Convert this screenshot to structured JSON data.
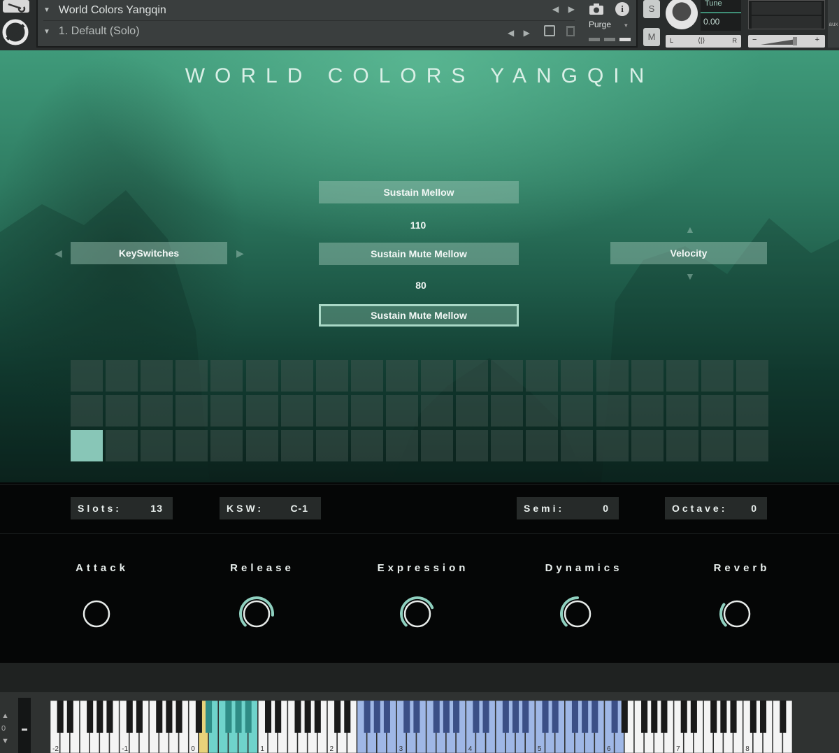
{
  "header": {
    "instrument_name": "World Colors Yangqin",
    "preset_name": "1. Default (Solo)",
    "purge_label": "Purge",
    "solo_label": "S",
    "mute_label": "M",
    "tune_label": "Tune",
    "tune_value": "0.00",
    "pan_left": "L",
    "pan_right": "R",
    "vol_minus": "−",
    "vol_plus": "+",
    "aux_label": "aux",
    "info_label": "i"
  },
  "title": "WORLD COLORS YANGQIN",
  "articulations": {
    "slot1": "Sustain Mellow",
    "value1": "110",
    "slot2": "Sustain Mute Mellow",
    "value2": "80",
    "slot3": "Sustain Mute Mellow"
  },
  "keyswitches_label": "KeySwitches",
  "velocity_label": "Velocity",
  "pad_grid": {
    "rows": 3,
    "cols": 20,
    "active_index": 40
  },
  "fields": {
    "slots_label": "Slots:",
    "slots_value": "13",
    "ksw_label": "KSW:",
    "ksw_value": "C-1",
    "semi_label": "Semi:",
    "semi_value": "0",
    "octave_label": "Octave:",
    "octave_value": "0"
  },
  "knobs": [
    {
      "label": "Attack",
      "value": 0.0
    },
    {
      "label": "Release",
      "value": 0.85
    },
    {
      "label": "Expression",
      "value": 0.75
    },
    {
      "label": "Dynamics",
      "value": 0.5
    },
    {
      "label": "Reverb",
      "value": 0.3
    }
  ],
  "keyboard": {
    "octave_shift": "0",
    "octave_labels": [
      "-2",
      "-1",
      "0",
      "1",
      "2",
      "3",
      "4",
      "5",
      "6",
      "7",
      "8"
    ],
    "colors": {
      "keyswitch": "#6fd3cb",
      "selected_key": "#e8d27a",
      "range": "#9fb7e6"
    }
  },
  "colors": {
    "accent": "#88c6b7",
    "knob_ring": "#8fd0bf"
  }
}
